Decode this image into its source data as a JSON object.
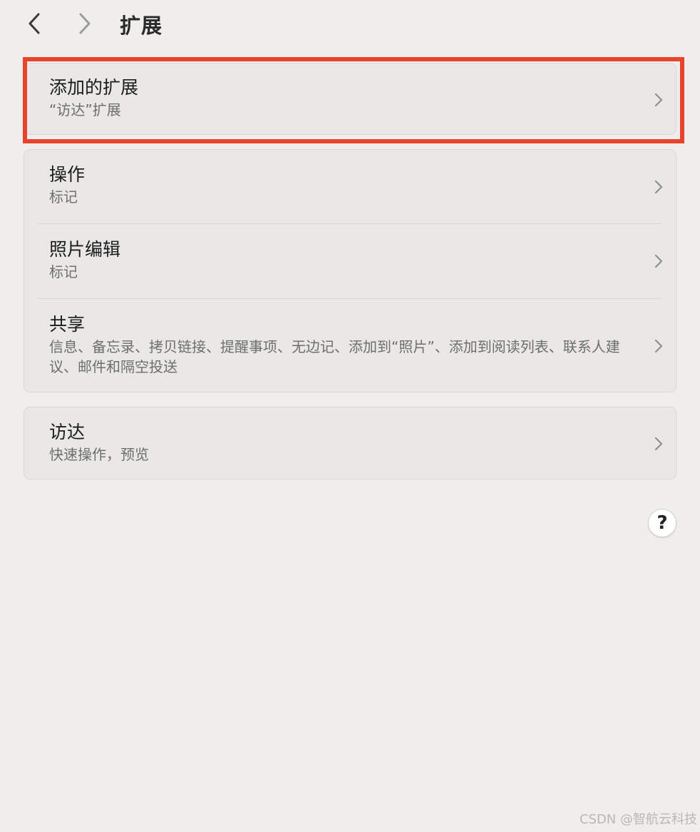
{
  "header": {
    "title": "扩展"
  },
  "groups": [
    {
      "rows": [
        {
          "title": "添加的扩展",
          "subtitle": "“访达”扩展"
        }
      ]
    },
    {
      "rows": [
        {
          "title": "操作",
          "subtitle": "标记"
        },
        {
          "title": "照片编辑",
          "subtitle": "标记"
        },
        {
          "title": "共享",
          "subtitle": "信息、备忘录、拷贝链接、提醒事项、无边记、添加到“照片”、添加到阅读列表、联系人建议、邮件和隔空投送"
        }
      ]
    },
    {
      "rows": [
        {
          "title": "访达",
          "subtitle": "快速操作，预览"
        }
      ]
    }
  ],
  "help": {
    "label": "?"
  },
  "watermark": "CSDN @智航云科技",
  "colors": {
    "background": "#efeeec",
    "group": "#e9e8e6",
    "highlight": "#e8432c"
  },
  "icons": {
    "back": "chevron-left-icon",
    "forward": "chevron-right-icon",
    "row": "chevron-right-icon"
  }
}
